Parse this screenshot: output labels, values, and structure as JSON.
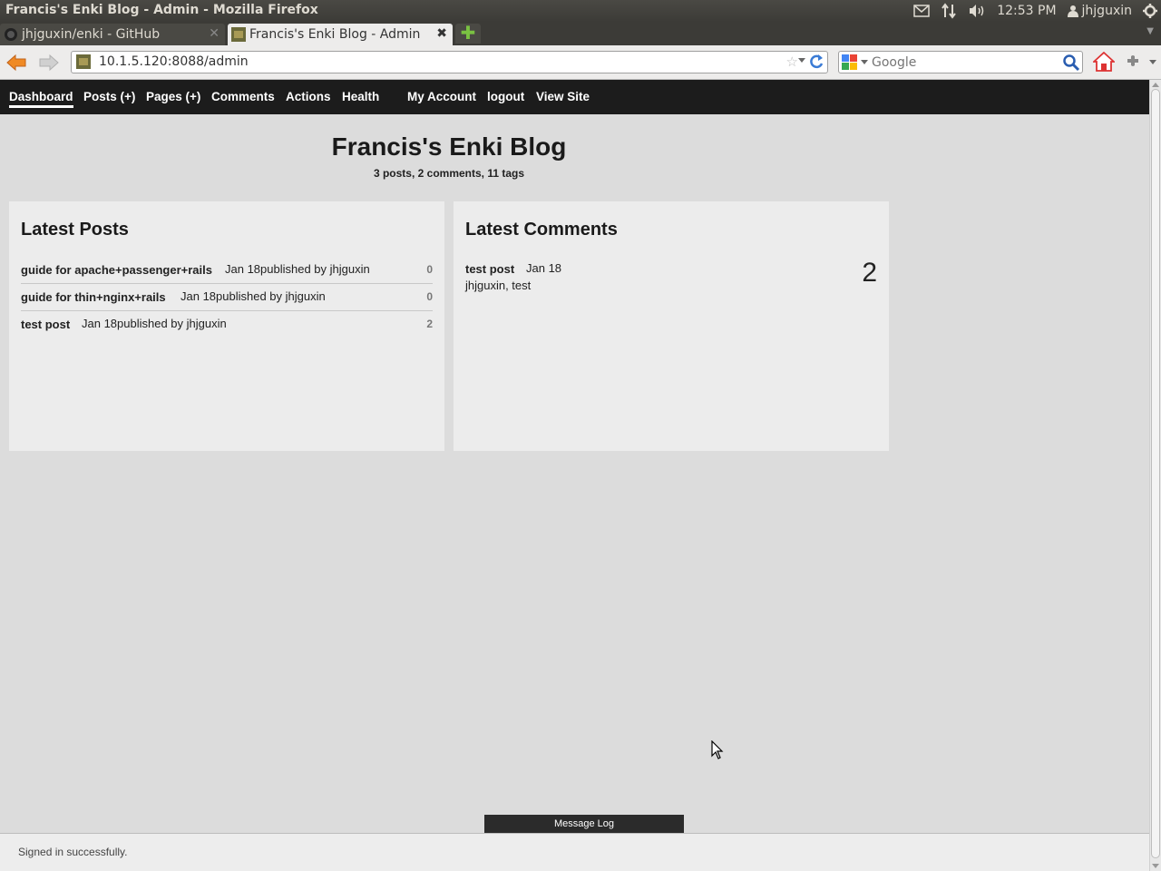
{
  "os": {
    "window_title": "Francis's Enki Blog - Admin - Mozilla Firefox",
    "clock": "12:53 PM",
    "user": "jhjguxin"
  },
  "browser": {
    "tabs": [
      {
        "label": "jhjguxin/enki - GitHub",
        "active": false
      },
      {
        "label": "Francis's Enki Blog - Admin",
        "active": true
      }
    ],
    "url": "10.1.5.120:8088/admin",
    "search_placeholder": "Google"
  },
  "admin_nav": {
    "items": [
      {
        "label": "Dashboard",
        "current": true
      },
      {
        "label": "Posts (+)"
      },
      {
        "label": "Pages (+)"
      },
      {
        "label": "Comments"
      },
      {
        "label": "Actions"
      },
      {
        "label": "Health"
      },
      {
        "label": "My Account"
      },
      {
        "label": "logout"
      },
      {
        "label": "View Site"
      }
    ]
  },
  "dashboard": {
    "title": "Francis's Enki Blog",
    "stats": "3 posts, 2 comments, 11 tags",
    "latest_posts": {
      "heading": "Latest Posts",
      "items": [
        {
          "title": "guide for apache+passenger+rails",
          "meta": "Jan 18published by jhjguxin",
          "comments": "0"
        },
        {
          "title": "guide for thin+nginx+rails",
          "meta": "Jan 18published by jhjguxin",
          "comments": "0"
        },
        {
          "title": "test post",
          "meta": "Jan 18published by jhjguxin",
          "comments": "2"
        }
      ]
    },
    "latest_comments": {
      "heading": "Latest Comments",
      "items": [
        {
          "post": "test post",
          "date": "Jan 18",
          "authors": "jhjguxin, test",
          "count": "2"
        }
      ]
    }
  },
  "message_log_label": "Message Log",
  "flash_message": "Signed in successfully."
}
